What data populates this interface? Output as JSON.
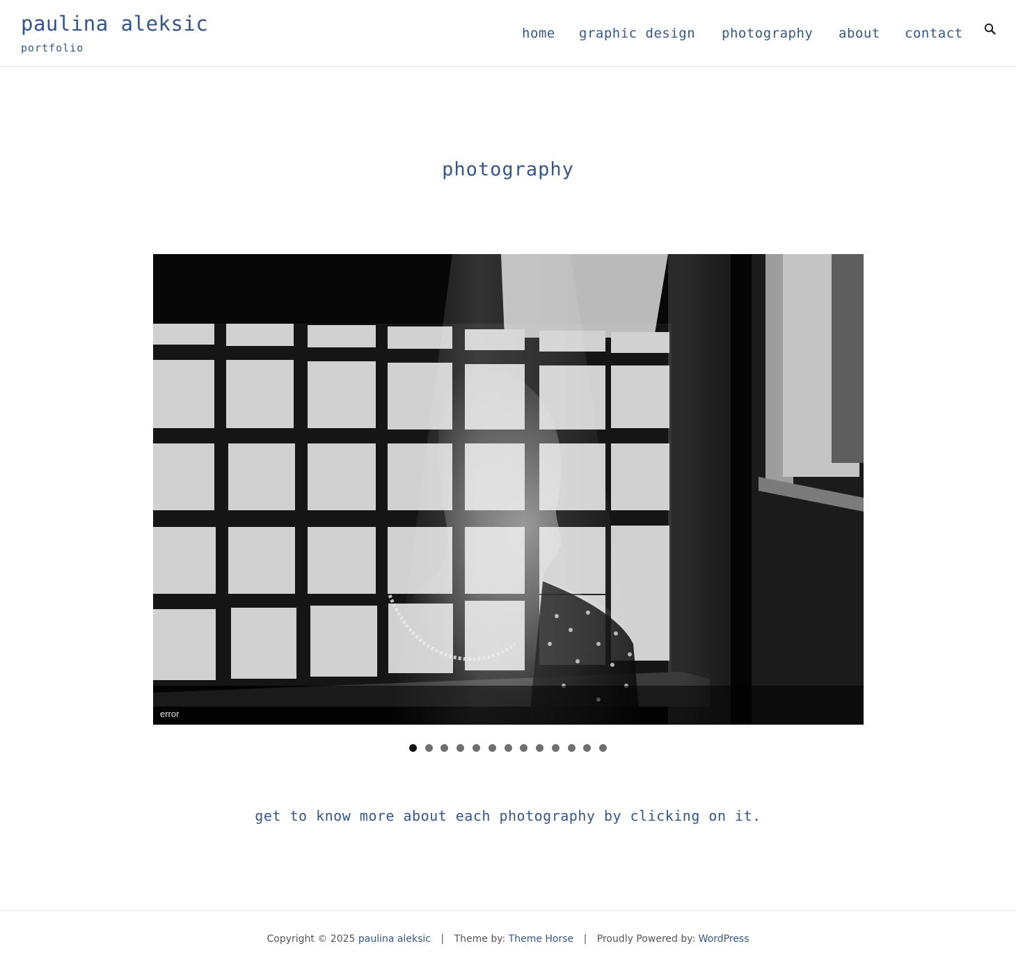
{
  "header": {
    "site_title": "paulina aleksic",
    "tagline": "portfolio",
    "nav": [
      {
        "label": "home"
      },
      {
        "label": "graphic design"
      },
      {
        "label": "photography"
      },
      {
        "label": "about"
      },
      {
        "label": "contact"
      }
    ],
    "search_icon": "search-icon"
  },
  "main": {
    "page_title": "photography",
    "slider": {
      "caption": "error",
      "slide_count": 13,
      "active_index": 0
    },
    "intro_text": "get to know more about each photography by clicking on it."
  },
  "footer": {
    "copyright_prefix": "Copyright © 2025",
    "site_link": "paulina aleksic",
    "separator": "|",
    "theme_prefix": "Theme by:",
    "theme_link": "Theme Horse",
    "powered_prefix": "Proudly Powered by:",
    "powered_link": "WordPress"
  },
  "colors": {
    "accent": "#35568a",
    "border": "#e3e3e3",
    "text_muted": "#555555"
  }
}
